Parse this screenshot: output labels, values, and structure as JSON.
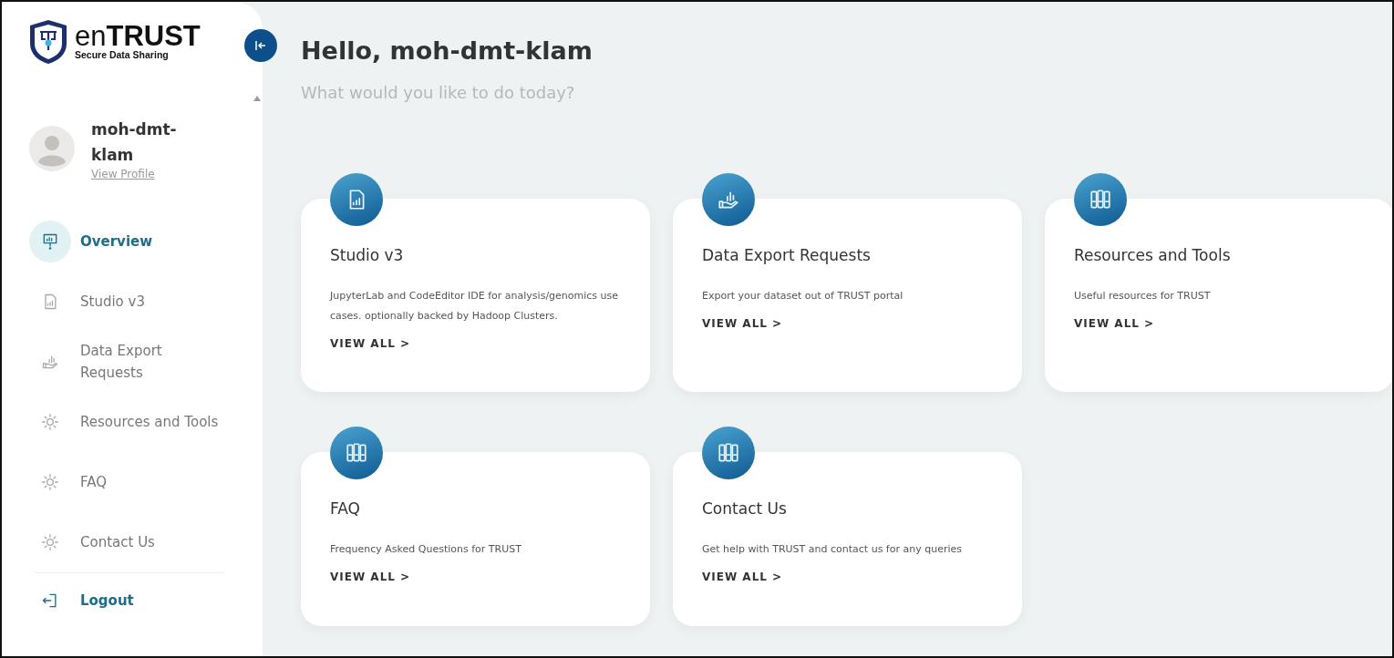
{
  "brand": {
    "prefix": "en",
    "main": "TRUST",
    "tagline": "Secure Data Sharing"
  },
  "user": {
    "name": "moh-dmt-klam",
    "profile_link": "View Profile"
  },
  "nav": [
    {
      "label": "Overview",
      "kind": "presentation",
      "selected": true
    },
    {
      "label": "Studio v3",
      "kind": "document",
      "selected": false
    },
    {
      "label": "Data Export Requests",
      "kind": "export",
      "selected": false
    },
    {
      "label": "Resources and Tools",
      "kind": "general",
      "selected": false
    },
    {
      "label": "FAQ",
      "kind": "general",
      "selected": false
    },
    {
      "label": "Contact Us",
      "kind": "general",
      "selected": false
    }
  ],
  "logout": {
    "label": "Logout"
  },
  "greeting": "Hello, moh-dmt-klam",
  "prompt": "What would you like to do today?",
  "cards": [
    {
      "title": "Studio v3",
      "kind": "document",
      "description": "JupyterLab and CodeEditor IDE for analysis/genomics use cases. optionally backed by Hadoop Clusters.",
      "link": "VIEW ALL >"
    },
    {
      "title": "Data Export Requests",
      "kind": "export",
      "description": "Export your dataset out of TRUST portal",
      "link": "VIEW ALL >"
    },
    {
      "title": "Resources and Tools",
      "kind": "library",
      "description": "Useful resources for TRUST",
      "link": "VIEW ALL >"
    },
    {
      "title": "FAQ",
      "kind": "library",
      "description": "Frequency Asked Questions for TRUST",
      "link": "VIEW ALL >"
    },
    {
      "title": "Contact Us",
      "kind": "library",
      "description": "Get help with TRUST and contact us for any queries",
      "link": "VIEW ALL >"
    }
  ]
}
